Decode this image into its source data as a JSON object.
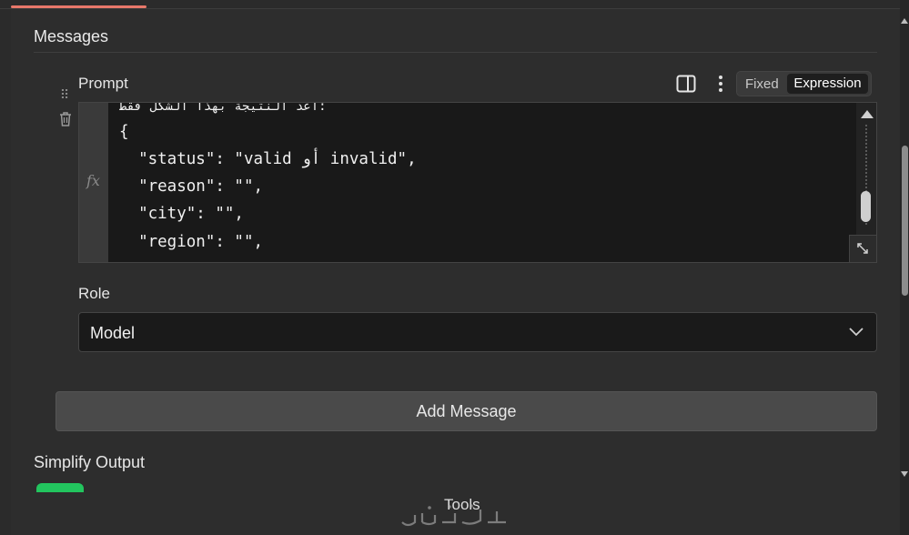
{
  "messages": {
    "title": "Messages",
    "prompt_label": "Prompt",
    "mode_toggle": {
      "fixed_label": "Fixed",
      "expression_label": "Expression",
      "selected": "Expression"
    },
    "editor": {
      "gutter_label": "fx",
      "code_lines": [
        "اعد النتيجة بهذا الشكل فقط:",
        "{",
        "  \"status\": \"valid أو invalid\",",
        "  \"reason\": \"\",",
        "  \"city\": \"\",",
        "  \"region\": \"\","
      ]
    },
    "role_label": "Role",
    "role_value": "Model",
    "add_message_label": "Add Message"
  },
  "simplify_output": {
    "label": "Simplify Output",
    "enabled": true
  },
  "tools_label": "Tools",
  "colors": {
    "accent": "#e8786a",
    "toggle_on": "#22c55e",
    "background": "#2b2b2b",
    "editor_bg": "#191919"
  },
  "icons": [
    "drag-handle-icon",
    "trash-icon",
    "split-panel-icon",
    "kebab-menu-icon",
    "chevron-down-icon",
    "expand-icon",
    "scroll-up-icon"
  ]
}
